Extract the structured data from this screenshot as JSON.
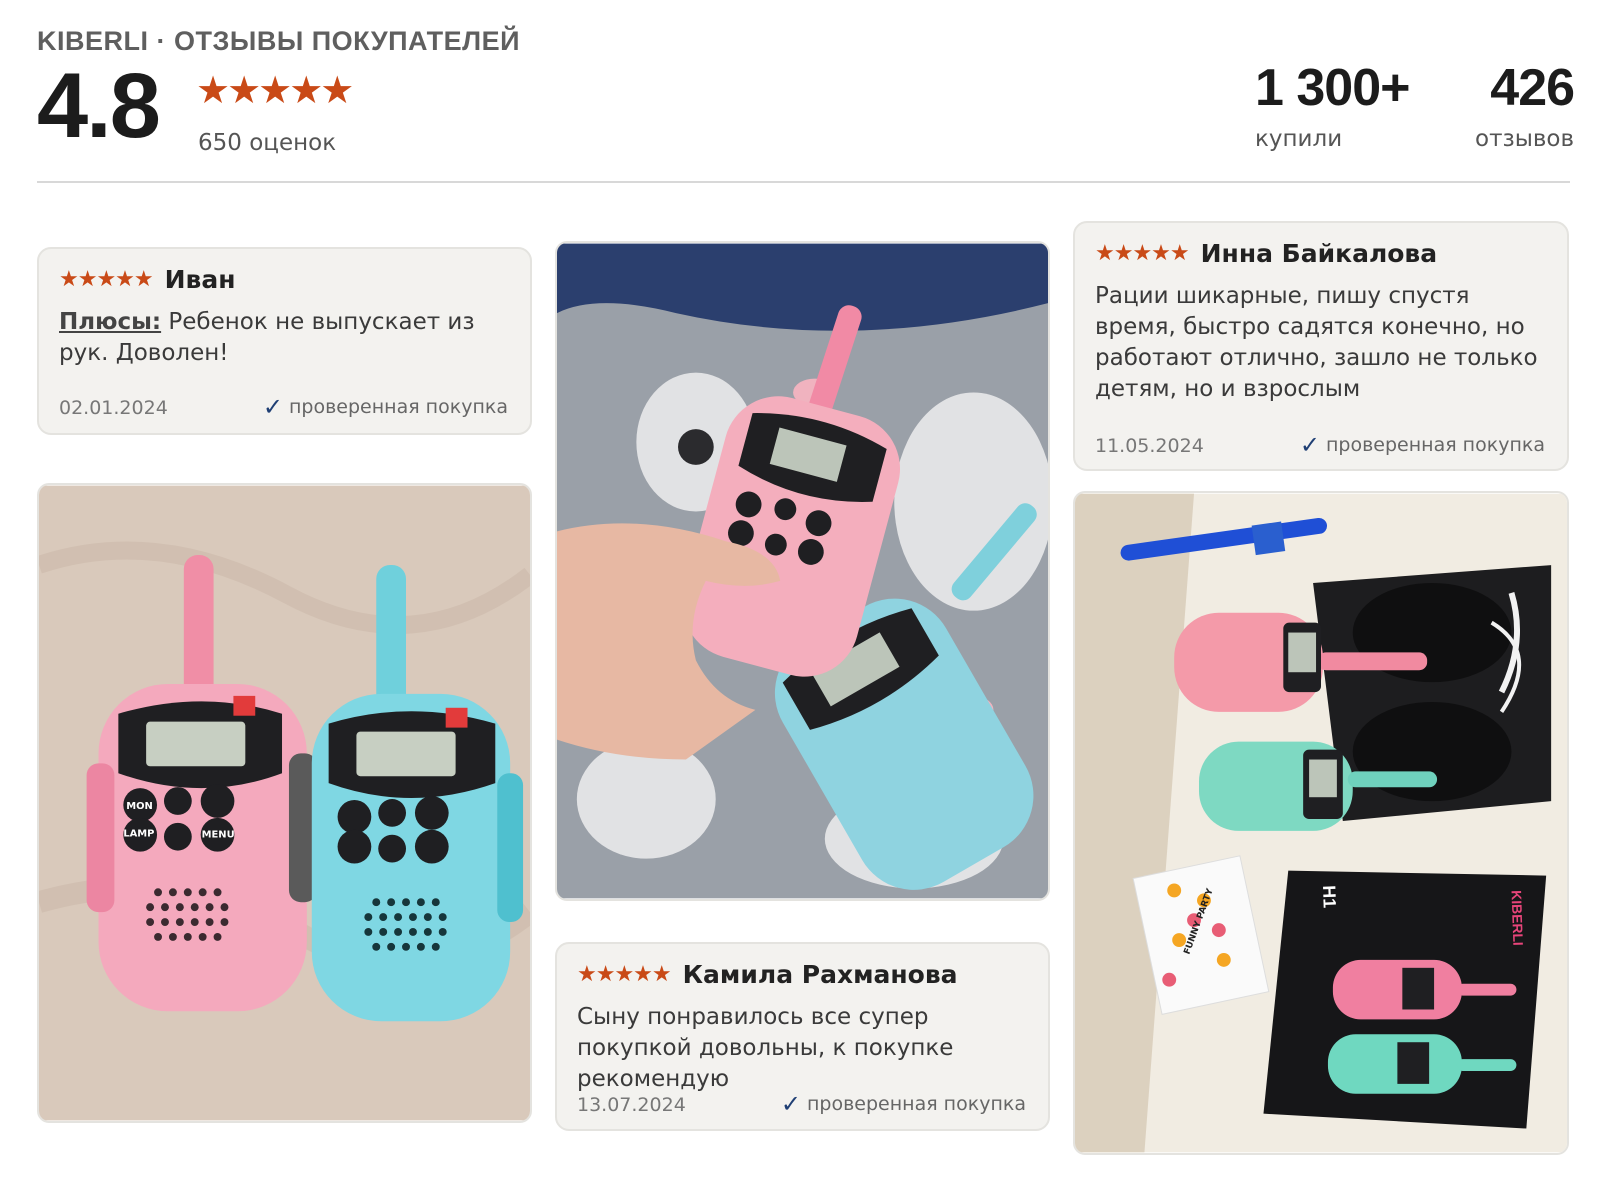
{
  "header": {
    "brand": "KIBERLI · ОТЗЫВЫ ПОКУПАТЕЛЕЙ",
    "rating": "4.8",
    "stars": "★★★★★",
    "ratings_count": "650 оценок",
    "bought_value": "1 300+",
    "bought_label": "купили",
    "reviews_value": "426",
    "reviews_label": "отзывов"
  },
  "reviews": [
    {
      "stars": "★★★★★",
      "author": "Иван",
      "pros_label": "Плюсы:",
      "text": " Ребенок не выпускает из рук. Доволен!",
      "date": "02.01.2024",
      "verified": "проверенная покупка"
    },
    {
      "stars": "★★★★★",
      "author": "Инна Байкалова",
      "text": "Рации шикарные, пишу спустя время, быстро садятся конечно, но работают отлично, зашло не только детям, но и взрослым",
      "date": "11.05.2024",
      "verified": "проверенная покупка"
    },
    {
      "stars": "★★★★★",
      "author": "Камила Рахманова",
      "text": "Сыну понравилось все супер покупкой довольны, к покупке рекомендую",
      "date": "13.07.2024",
      "verified": "проверенная покупка"
    }
  ],
  "photos": {
    "ivan": {
      "btn_mon": "MON",
      "btn_lamp": "LAMP",
      "btn_menu": "MENU"
    },
    "box": {
      "brand": "KIBERLI",
      "model": "H1",
      "sticker": "FUNNY PARTY"
    }
  },
  "colors": {
    "star": "#c94a17",
    "check": "#1f3f74",
    "card_bg": "#f3f2ef"
  }
}
